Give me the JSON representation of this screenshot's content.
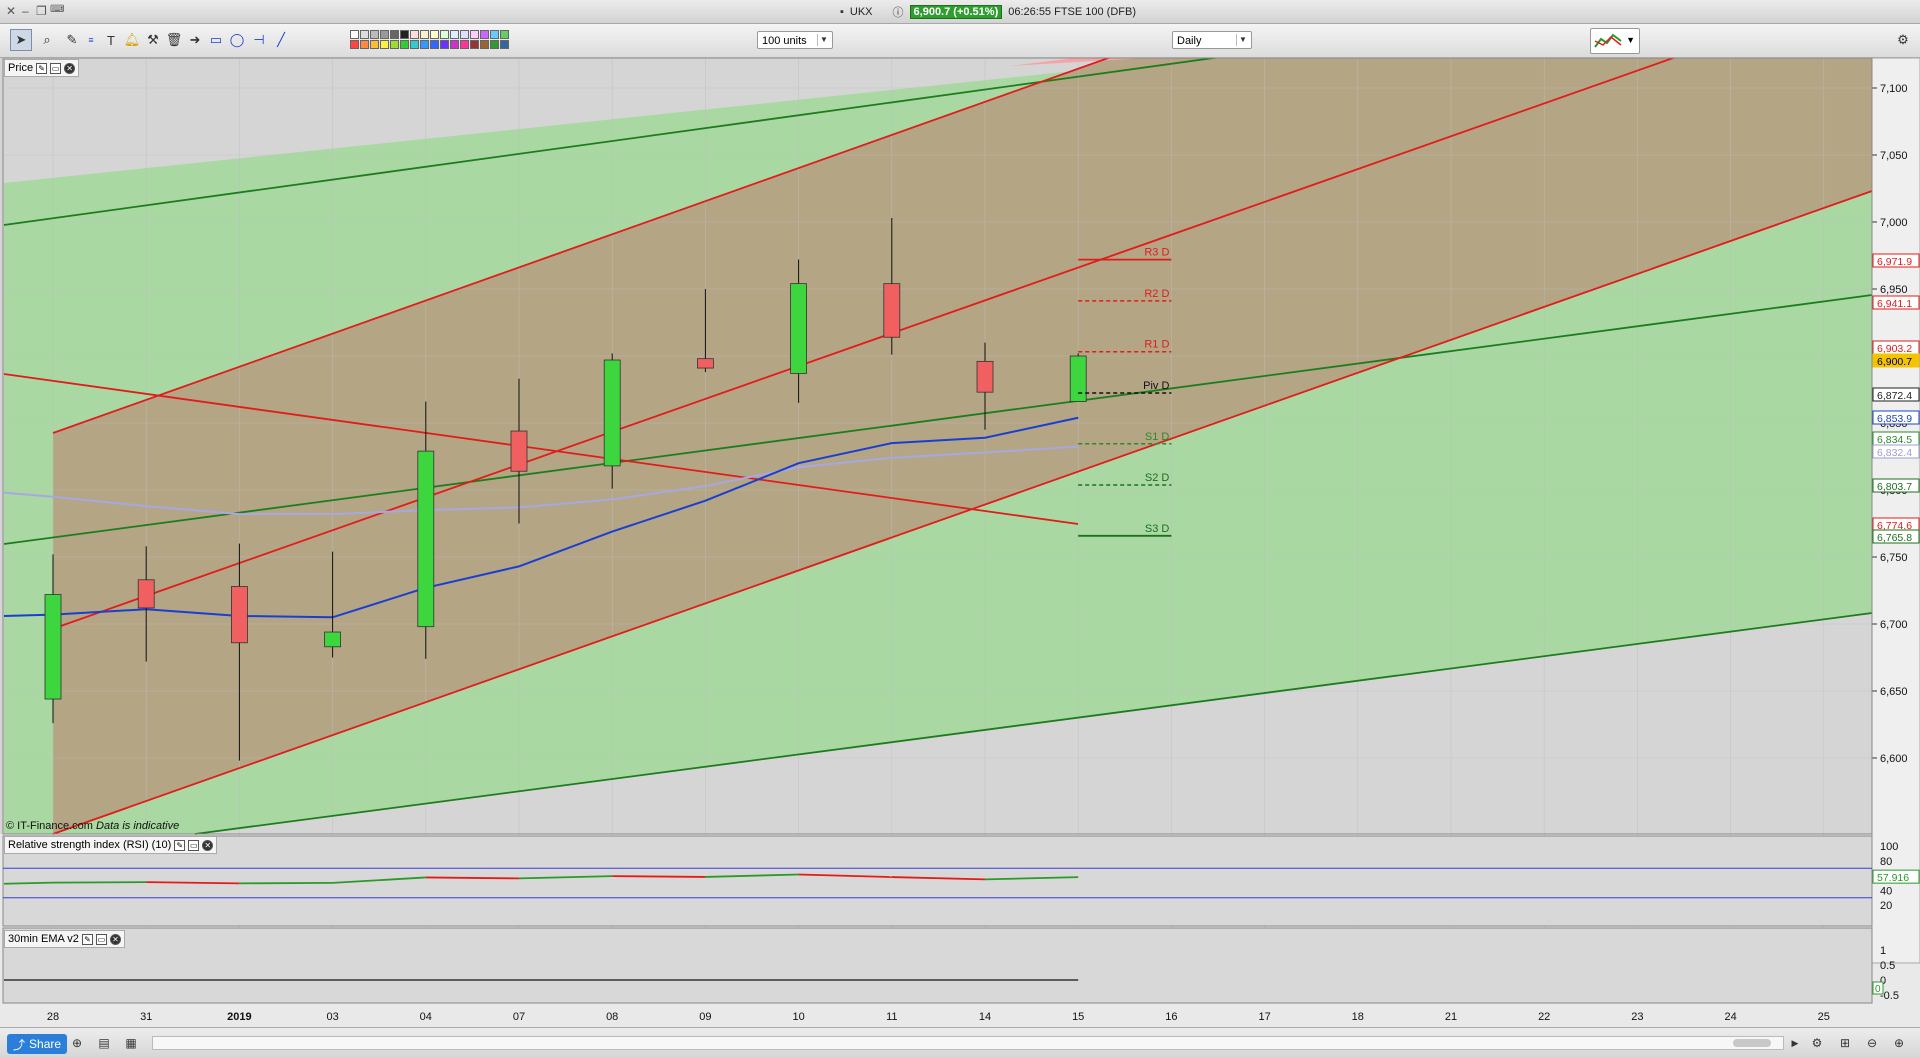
{
  "window": {
    "symbol": "UKX",
    "quote": "6,900.7 (+0.51%)",
    "title": "06:26:55 FTSE 100 (DFB)"
  },
  "toolbar": {
    "units_select": "100 units",
    "interval_select": "Daily",
    "tools": [
      "pointer-icon",
      "zoom-icon",
      "draw-icon",
      "fib-icon",
      "text-icon",
      "alert-icon",
      "tools-icon",
      "trash-icon",
      "arrow-icon",
      "rectangle-icon",
      "ellipse-icon",
      "hline-icon",
      "trendline-icon"
    ],
    "swatch_colors": [
      "#ffffff",
      "#dddddd",
      "#bbbbbb",
      "#999999",
      "#666666",
      "#222222",
      "#ffdddd",
      "#ffeecc",
      "#ffffcc",
      "#ddffdd",
      "#ddeeff",
      "#ddddff",
      "#ffccff",
      "#cc66ff",
      "#66ccff",
      "#66cc66",
      "#ff4444",
      "#ff8844",
      "#ffbb33",
      "#ffee44",
      "#99dd33",
      "#33cc33",
      "#33cccc",
      "#3399ff",
      "#3366ff",
      "#6633ff",
      "#cc33cc",
      "#ff3399",
      "#993333",
      "#996633",
      "#339933",
      "#336699"
    ]
  },
  "panels": {
    "price": {
      "title": "Price"
    },
    "rsi": {
      "title": "Relative strength index (RSI) (10)"
    },
    "ema": {
      "title": "30min EMA v2"
    }
  },
  "footer": {
    "source": "© IT-Finance.com",
    "note": "Data is indicative"
  },
  "bottombar": {
    "share_label": "Share"
  },
  "chart_data": {
    "type": "candlestick",
    "x_labels": [
      "28",
      "31",
      "2019",
      "03",
      "04",
      "07",
      "08",
      "09",
      "10",
      "11",
      "14",
      "15",
      "16",
      "17",
      "18",
      "21",
      "22",
      "23",
      "24",
      "25"
    ],
    "y_ticks": [
      "7,100",
      "7,050",
      "7,000",
      "6,950",
      "6,900",
      "6,850",
      "6,800",
      "6,750",
      "6,700",
      "6,650",
      "6,600"
    ],
    "y_tick_values": [
      7100,
      7050,
      7000,
      6950,
      6900,
      6850,
      6800,
      6750,
      6700,
      6650,
      6600
    ],
    "ylim": [
      6555,
      7135
    ],
    "candles": [
      {
        "date": "28",
        "open": 6644,
        "high": 6752,
        "low": 6626,
        "close": 6722
      },
      {
        "date": "31",
        "open": 6733,
        "high": 6758,
        "low": 6672,
        "close": 6712
      },
      {
        "date": "2019",
        "open": 6728,
        "high": 6760,
        "low": 6598,
        "close": 6686
      },
      {
        "date": "03",
        "open": 6683,
        "high": 6754,
        "low": 6675,
        "close": 6694
      },
      {
        "date": "04",
        "open": 6698,
        "high": 6866,
        "low": 6674,
        "close": 6829
      },
      {
        "date": "07",
        "open": 6844,
        "high": 6883,
        "low": 6775,
        "close": 6814
      },
      {
        "date": "08",
        "open": 6818,
        "high": 6902,
        "low": 6801,
        "close": 6897
      },
      {
        "date": "09",
        "open": 6898,
        "high": 6950,
        "low": 6888,
        "close": 6891
      },
      {
        "date": "10",
        "open": 6887,
        "high": 6972,
        "low": 6865,
        "close": 6954
      },
      {
        "date": "11",
        "open": 6954,
        "high": 7003,
        "low": 6901,
        "close": 6914
      },
      {
        "date": "14",
        "open": 6896,
        "high": 6910,
        "low": 6845,
        "close": 6873
      },
      {
        "date": "15",
        "open": 6866,
        "high": 6902,
        "low": 6866,
        "close": 6900
      }
    ],
    "ma_blue": [
      6707,
      6711,
      6706,
      6705,
      6727,
      6743,
      6769,
      6792,
      6820,
      6835,
      6839,
      6853.9
    ],
    "ma_lavender": [
      6795,
      6788,
      6782,
      6782,
      6785,
      6787,
      6793,
      6803,
      6817,
      6824,
      6828,
      6832.4
    ],
    "pivots": [
      {
        "label": "R3 D",
        "value": 6971.9,
        "color": "#e21b1b"
      },
      {
        "label": "R2 D",
        "value": 6941.1,
        "color": "#e21b1b"
      },
      {
        "label": "R1 D",
        "value": 6903.2,
        "color": "#e21b1b"
      },
      {
        "label": "Piv D",
        "value": 6872.4,
        "color": "#111111"
      },
      {
        "label": "S1 D",
        "value": 6834.5,
        "color": "#2a8a2a"
      },
      {
        "label": "S2 D",
        "value": 6803.7,
        "color": "#1d6f1d"
      },
      {
        "label": "S3 D",
        "value": 6765.8,
        "color": "#1d6f1d"
      }
    ],
    "price_labels": [
      {
        "text": "6,971.9",
        "color": "#e21b1b",
        "text_color": "#e21b1b"
      },
      {
        "text": "6,941.1",
        "color": "#e21b1b",
        "text_color": "#e21b1b"
      },
      {
        "text": "6,903.2",
        "color": "#e21b1b",
        "text_color": "#e21b1b"
      },
      {
        "text": "6,900.7",
        "color": "#f4c400",
        "text_color": "#000000",
        "fill": "#f4c400"
      },
      {
        "text": "6,872.4",
        "color": "#222222",
        "text_color": "#222222"
      },
      {
        "text": "6,853.9",
        "color": "#1a3fd0",
        "text_color": "#1a3fd0"
      },
      {
        "text": "6,834.5",
        "color": "#2a8a2a",
        "text_color": "#2a8a2a"
      },
      {
        "text": "6,832.4",
        "color": "#9c9cd6",
        "text_color": "#9c9cd6"
      },
      {
        "text": "6,803.7",
        "color": "#1d6f1d",
        "text_color": "#1d6f1d"
      },
      {
        "text": "6,774.6",
        "color": "#e21b1b",
        "text_color": "#e21b1b"
      },
      {
        "text": "6,765.8",
        "color": "#1d6f1d",
        "text_color": "#1d6f1d"
      }
    ],
    "rsi": {
      "y_ticks": [
        "100",
        "80",
        "40",
        "20"
      ],
      "y_tick_values": [
        100,
        80,
        40,
        20
      ],
      "levels": [
        70,
        30
      ],
      "values": [
        50.5,
        51.2,
        49.5,
        50.2,
        57.5,
        56.2,
        59.3,
        58.2,
        61.5,
        58.0,
        54.9,
        57.916
      ],
      "last_label": "57.916"
    },
    "ema": {
      "y_ticks": [
        "1",
        "0.5",
        "0",
        "-0.5"
      ],
      "y_tick_values": [
        1,
        0.5,
        0,
        -0.5
      ],
      "value": 0,
      "last_label": "0"
    },
    "colors": {
      "up": "#3ed63e",
      "down": "#f06060",
      "channel_red": "#e21b1b",
      "channel_green": "#1d7d1d"
    }
  }
}
